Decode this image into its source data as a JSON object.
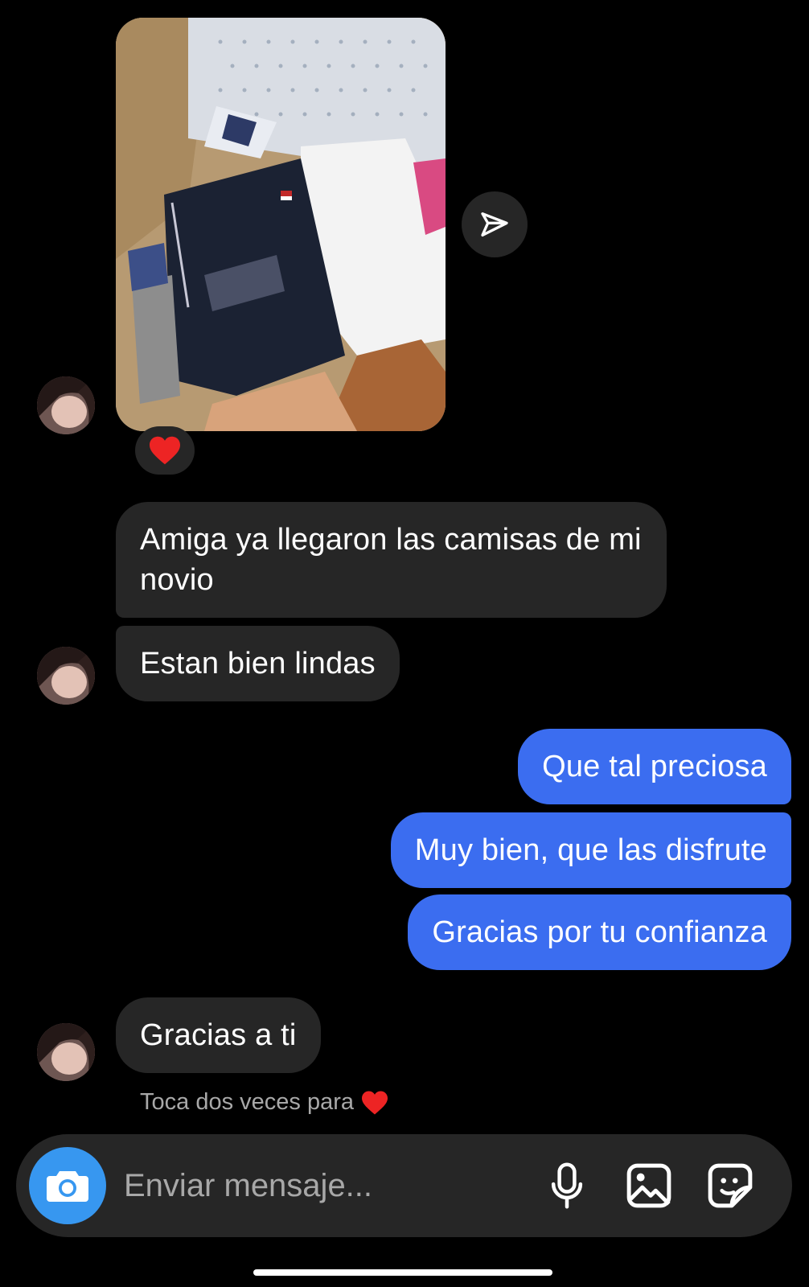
{
  "colors": {
    "background": "#000000",
    "incoming_bubble": "#262626",
    "outgoing_bubble": "#3b6df0",
    "camera_button": "#3797f0",
    "heart": "#ed2424"
  },
  "shared_photo": {
    "description_icon": "photo-thumbnail",
    "reaction": "heart"
  },
  "messages": [
    {
      "from": "them",
      "text": "Amiga ya llegaron las camisas de mi novio"
    },
    {
      "from": "them",
      "text": "Estan bien lindas"
    },
    {
      "from": "me",
      "text": "Que tal preciosa"
    },
    {
      "from": "me",
      "text": "Muy bien, que las disfrute"
    },
    {
      "from": "me",
      "text": "Gracias por tu confianza"
    },
    {
      "from": "them",
      "text": "Gracias a ti"
    }
  ],
  "hint": {
    "text": "Toca dos veces para",
    "icon": "heart"
  },
  "composer": {
    "placeholder": "Enviar mensaje...",
    "icons": [
      "camera-icon",
      "microphone-icon",
      "gallery-icon",
      "sticker-icon"
    ]
  }
}
